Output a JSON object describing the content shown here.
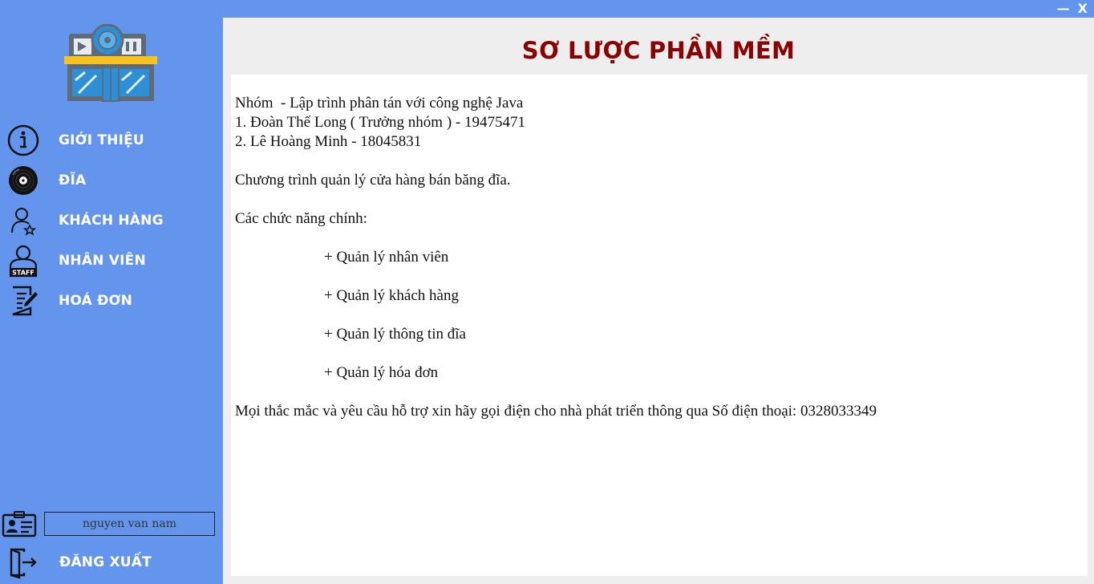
{
  "window": {
    "minimize_label": "—",
    "close_label": "X"
  },
  "sidebar": {
    "items": [
      {
        "label": "GIỚI THIỆU",
        "icon": "info-icon"
      },
      {
        "label": "ĐĨA",
        "icon": "disc-icon"
      },
      {
        "label": "KHÁCH HÀNG",
        "icon": "customer-icon"
      },
      {
        "label": "NHÂN VIÊN",
        "icon": "staff-icon"
      },
      {
        "label": "HOÁ ĐƠN",
        "icon": "invoice-icon"
      }
    ],
    "username": "nguyen van nam",
    "logout_label": "ĐĂNG XUẤT"
  },
  "main": {
    "title": "SƠ LƯỢC PHẦN MỀM",
    "lines": [
      "Nhóm  - Lập trình phân tán với công nghệ Java",
      "1. Đoàn Thế Long ( Trưởng nhóm ) - 19475471",
      "2. Lê Hoàng Minh - 18045831",
      "",
      "Chương trình quản lý cửa hàng bán băng đĩa.",
      "",
      "Các chức năng chính:",
      "",
      "+ Quản lý nhân viên",
      "",
      "+ Quản lý khách hàng",
      "",
      "+ Quản lý thông tin đĩa",
      "",
      "+ Quản lý hóa đơn",
      "",
      "Mọi thắc mắc và yêu cầu hỗ trợ xin hãy gọi điện cho nhà phát triển thông qua Số điện thoại: 0328033349"
    ]
  },
  "colors": {
    "sidebar_bg": "#6495ED",
    "title_color": "#8B0000",
    "main_bg": "#EEEEEE"
  }
}
